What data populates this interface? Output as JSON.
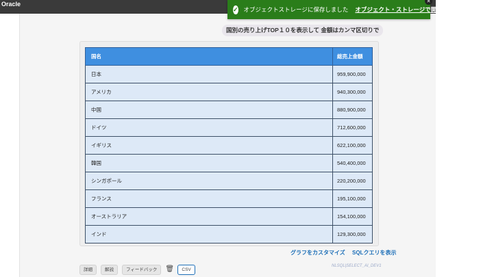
{
  "app": {
    "brand": "Oracle"
  },
  "toast": {
    "message": "オブジェクトストレージに保存しました",
    "link": "オブジェクト・ストレージで開く",
    "close": "✕"
  },
  "prompt": "国別の売り上げTOP１０を表示して 金額はカンマ区切りで",
  "table": {
    "headers": [
      "国名",
      "総売上金額"
    ],
    "rows": [
      [
        "日本",
        "959,900,000"
      ],
      [
        "アメリカ",
        "940,300,000"
      ],
      [
        "中国",
        "880,900,000"
      ],
      [
        "ドイツ",
        "712,600,000"
      ],
      [
        "イギリス",
        "622,100,000"
      ],
      [
        "韓国",
        "540,400,000"
      ],
      [
        "シンガポール",
        "220,200,000"
      ],
      [
        "フランス",
        "195,100,000"
      ],
      [
        "オーストラリア",
        "154,100,000"
      ],
      [
        "インド",
        "129,300,000"
      ]
    ]
  },
  "links": {
    "customize_graph": "グラフをカスタマイズ",
    "show_sql": "SQLクエリを表示"
  },
  "toolbar": {
    "detail": "詳細",
    "explain": "解説",
    "feedback": "フィードバック",
    "csv": "CSV"
  },
  "tag": "NLSQL|SELECT_AI_DEV1",
  "colors": {
    "toast_bg": "#2a7d1a",
    "header_bg": "#3f8fe0",
    "row_bg": "#dde9f7",
    "link": "#1d6fb8"
  }
}
